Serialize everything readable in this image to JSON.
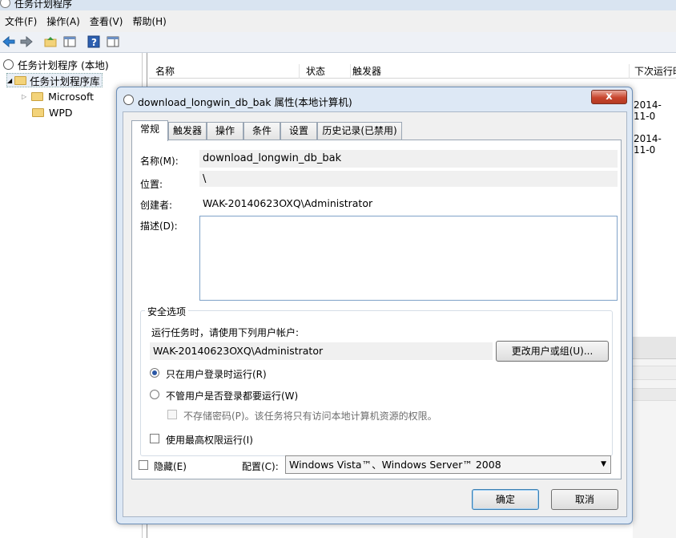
{
  "window": {
    "title": "任务计划程序"
  },
  "menu": [
    "文件(F)",
    "操作(A)",
    "查看(V)",
    "帮助(H)"
  ],
  "tree": {
    "root": "任务计划程序 (本地)",
    "library": "任务计划程序库",
    "children": [
      "Microsoft",
      "WPD"
    ]
  },
  "list": {
    "columns": [
      "名称",
      "状态",
      "触发器",
      "下次运行时"
    ],
    "next_run_values": [
      "2014-11-0",
      "2014-11-0"
    ]
  },
  "dialog": {
    "title": "download_longwin_db_bak 属性(本地计算机)",
    "close_glyph": "x",
    "tabs": [
      "常规",
      "触发器",
      "操作",
      "条件",
      "设置",
      "历史记录(已禁用)"
    ],
    "general": {
      "name_label": "名称(M):",
      "name_value": "download_longwin_db_bak",
      "location_label": "位置:",
      "location_value": "\\",
      "author_label": "创建者:",
      "author_value": "WAK-20140623OXQ\\Administrator",
      "description_label": "描述(D):",
      "description_value": ""
    },
    "security": {
      "legend": "安全选项",
      "run_as_prompt": "运行任务时，请使用下列用户帐户:",
      "user_account": "WAK-20140623OXQ\\Administrator",
      "change_user_button": "更改用户或组(U)...",
      "radio_logged_on": "只在用户登录时运行(R)",
      "radio_whether_logged_on": "不管用户是否登录都要运行(W)",
      "no_store_password": "不存储密码(P)。该任务将只有访问本地计算机资源的权限。",
      "highest_privileges": "使用最高权限运行(I)",
      "selected_radio": "logged_on"
    },
    "hidden_label": "隐藏(E)",
    "config_label": "配置(C):",
    "config_value": "Windows Vista™、Windows Server™ 2008",
    "ok_button": "确定",
    "cancel_button": "取消"
  }
}
